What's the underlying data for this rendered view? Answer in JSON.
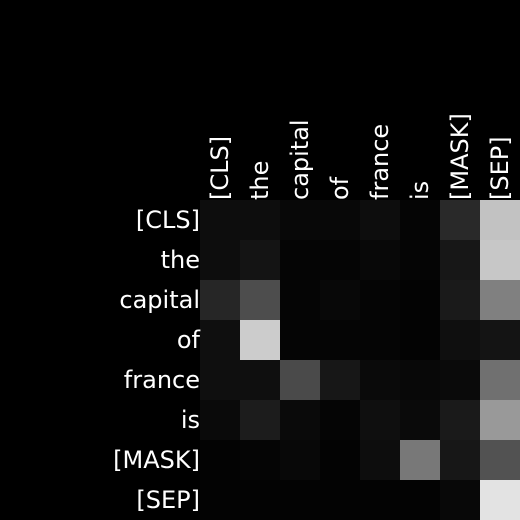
{
  "chart_data": {
    "type": "heatmap",
    "colormap": "grayscale",
    "background": "#000000",
    "row_labels": [
      "[CLS]",
      "the",
      "capital",
      "of",
      "france",
      "is",
      "[MASK]",
      "[SEP]"
    ],
    "column_labels": [
      "[CLS]",
      "the",
      "capital",
      "of",
      "france",
      "is",
      "[MASK]",
      "[SEP]"
    ],
    "value_range": [
      0,
      1
    ],
    "values": [
      [
        0.05,
        0.05,
        0.03,
        0.03,
        0.05,
        0.02,
        0.16,
        0.76
      ],
      [
        0.05,
        0.08,
        0.02,
        0.02,
        0.03,
        0.02,
        0.09,
        0.78
      ],
      [
        0.15,
        0.3,
        0.02,
        0.03,
        0.02,
        0.01,
        0.1,
        0.5
      ],
      [
        0.06,
        0.8,
        0.02,
        0.02,
        0.02,
        0.01,
        0.06,
        0.08
      ],
      [
        0.06,
        0.06,
        0.29,
        0.09,
        0.04,
        0.03,
        0.04,
        0.44
      ],
      [
        0.04,
        0.11,
        0.04,
        0.02,
        0.06,
        0.04,
        0.1,
        0.6
      ],
      [
        0.01,
        0.02,
        0.03,
        0.01,
        0.05,
        0.47,
        0.09,
        0.32
      ],
      [
        0.01,
        0.01,
        0.01,
        0.01,
        0.01,
        0.01,
        0.03,
        0.89
      ]
    ]
  }
}
